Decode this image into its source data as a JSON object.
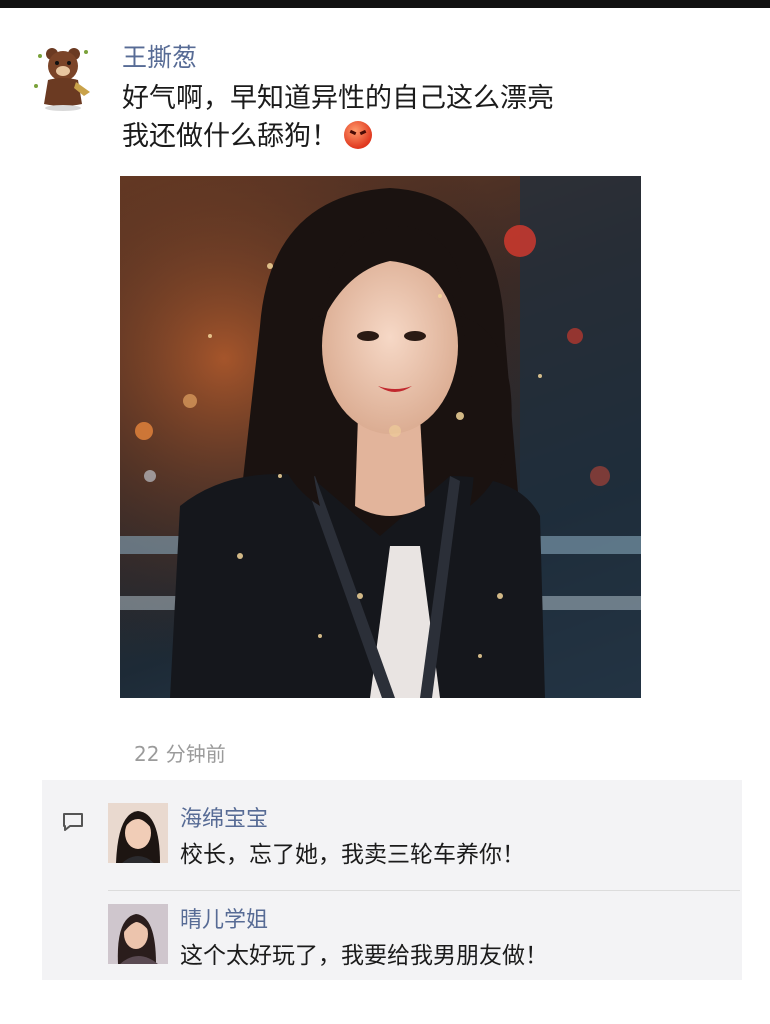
{
  "post": {
    "author": "王撕葱",
    "text_line1": "好气啊，早知道异性的自己这么漂亮",
    "text_line2": "我还做什么舔狗！",
    "emoji": "angry-face-emoji",
    "time": "22 分钟前"
  },
  "comments": [
    {
      "name": "海绵宝宝",
      "text": "校长，忘了她，我卖三轮车养你！"
    },
    {
      "name": "晴儿学姐",
      "text": "这个太好玩了，我要给我男朋友做！"
    }
  ],
  "colors": {
    "name_link": "#576b95",
    "body_text": "#1b1b1b",
    "timestamp": "#9b9b9b",
    "comment_bg": "#f3f3f5"
  }
}
